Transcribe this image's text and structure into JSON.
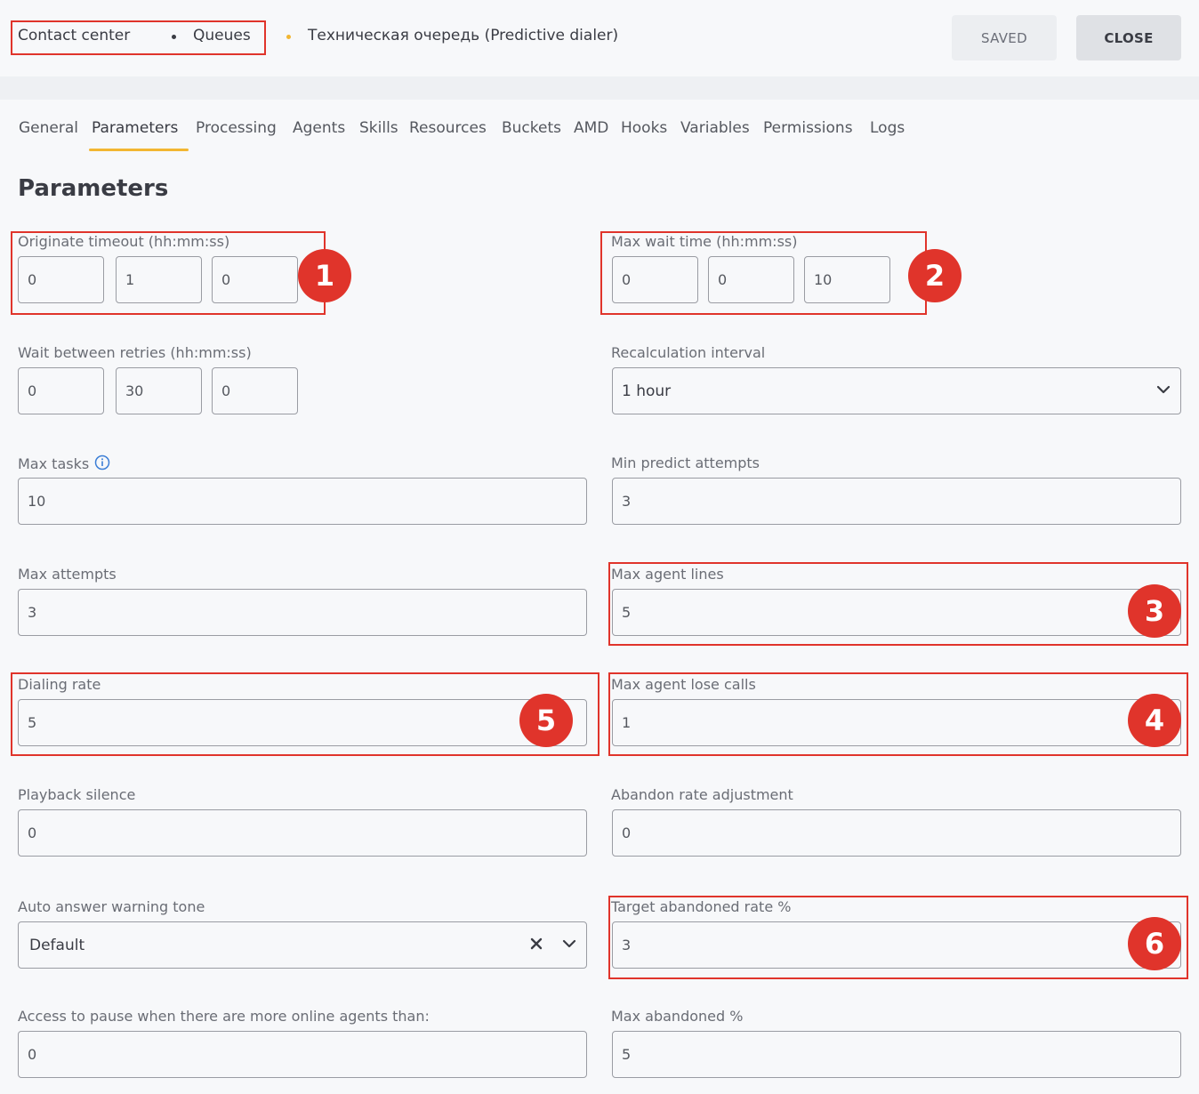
{
  "breadcrumb": {
    "root": "Contact center",
    "section": "Queues",
    "current": "Техническая очередь (Predictive dialer)",
    "separator_color": "#3a3c44",
    "accent_color": "#f2b632"
  },
  "header_buttons": {
    "saved": "SAVED",
    "close": "CLOSE"
  },
  "tabs": [
    "General",
    "Parameters",
    "Processing",
    "Agents",
    "Skills",
    "Resources",
    "Buckets",
    "AMD",
    "Hooks",
    "Variables",
    "Permissions",
    "Logs"
  ],
  "active_tab": "Parameters",
  "section_title": "Parameters",
  "fields": {
    "originate_timeout": {
      "label": "Originate timeout (hh:mm:ss)",
      "hh": "0",
      "mm": "1",
      "ss": "0"
    },
    "max_wait_time": {
      "label": "Max wait time (hh:mm:ss)",
      "hh": "0",
      "mm": "0",
      "ss": "10"
    },
    "wait_between_retries": {
      "label": "Wait between retries (hh:mm:ss)",
      "hh": "0",
      "mm": "30",
      "ss": "0"
    },
    "recalculation_interval": {
      "label": "Recalculation interval",
      "value": "1 hour"
    },
    "max_tasks": {
      "label": "Max tasks",
      "value": "10"
    },
    "min_predict_attempts": {
      "label": "Min predict attempts",
      "value": "3"
    },
    "max_attempts": {
      "label": "Max attempts",
      "value": "3"
    },
    "max_agent_lines": {
      "label": "Max agent lines",
      "value": "5"
    },
    "dialing_rate": {
      "label": "Dialing rate",
      "value": "5"
    },
    "max_agent_lose_calls": {
      "label": "Max agent lose calls",
      "value": "1"
    },
    "playback_silence": {
      "label": "Playback silence",
      "value": "0"
    },
    "abandon_rate_adjustment": {
      "label": "Abandon rate adjustment",
      "value": "0"
    },
    "auto_answer_warning_tone": {
      "label": "Auto answer warning tone",
      "value": "Default"
    },
    "target_abandoned_rate": {
      "label": "Target abandoned rate %",
      "value": "3"
    },
    "access_to_pause": {
      "label": "Access to pause when there are more online agents than:",
      "value": "0"
    },
    "max_abandoned": {
      "label": "Max abandoned %",
      "value": "5"
    }
  },
  "annotations": {
    "color": "#e0342b",
    "badges": [
      "1",
      "2",
      "3",
      "4",
      "5",
      "6"
    ]
  }
}
